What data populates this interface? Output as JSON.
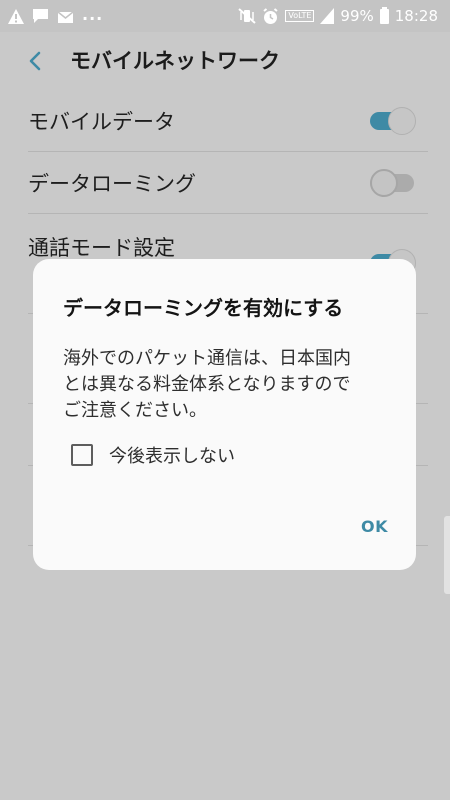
{
  "status_bar": {
    "battery_text": "99%",
    "time": "18:28",
    "more_indicator": "...",
    "volte_badge": "VoLTE"
  },
  "app_bar": {
    "title": "モバイルネットワーク"
  },
  "settings": {
    "mobile_data": {
      "label": "モバイルデータ",
      "toggle_on": true
    },
    "data_roaming": {
      "label": "データローミング",
      "toggle_on": false
    },
    "call_mode": {
      "label": "通話モード設定",
      "toggle_on": true
    }
  },
  "dialog": {
    "title": "データローミングを有効にする",
    "message": "海外でのパケット通信は、日本国内\nとは異なる料金体系となりますので\nご注意ください。",
    "checkbox_label": "今後表示しない",
    "checkbox_checked": false,
    "ok_label": "OK"
  },
  "colors": {
    "accent": "#3e8aa5",
    "background_dimmed": "#c9c9c9",
    "dialog_background": "#fafafa"
  }
}
